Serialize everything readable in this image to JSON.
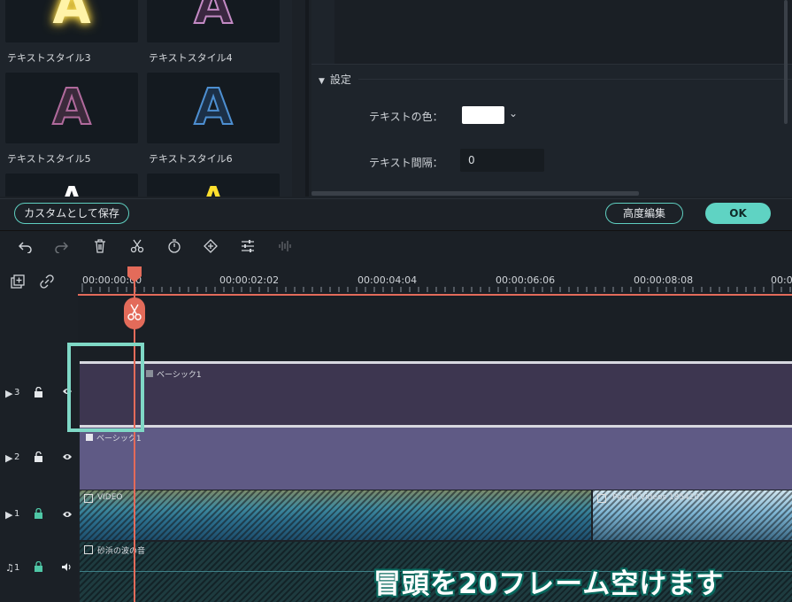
{
  "text_styles": [
    {
      "label": "テキストスタイル3",
      "glyph": "A",
      "color": "#ffe98a"
    },
    {
      "label": "テキストスタイル4",
      "glyph": "A",
      "color": "#8a4f86"
    },
    {
      "label": "テキストスタイル5",
      "glyph": "A",
      "color": "#7e3f6c"
    },
    {
      "label": "テキストスタイル6",
      "glyph": "A",
      "color": "#2d5b8e"
    },
    {
      "label": "",
      "glyph": "A",
      "color": "#ffffff"
    },
    {
      "label": "",
      "glyph": "A",
      "color": "#ffdf2c"
    }
  ],
  "settings": {
    "section_label": "設定",
    "text_color_label": "テキストの色：",
    "text_color_value": "#ffffff",
    "text_spacing_label": "テキスト間隔：",
    "text_spacing_value": "0"
  },
  "buttons": {
    "save_custom": "カスタムとして保存",
    "advanced_edit": "高度編集",
    "ok": "OK"
  },
  "toolbar": {
    "icons": [
      "undo-icon",
      "redo-icon",
      "delete-icon",
      "split-icon",
      "speed-icon",
      "keyframe-icon",
      "adjust-icon",
      "audio-wave-icon"
    ]
  },
  "timeline": {
    "ruler_labels": [
      "00:00:00:00",
      "00:00:02:02",
      "00:00:04:04",
      "00:00:06:06",
      "00:00:08:08",
      "00:0"
    ],
    "accent_color": "#e36b5a",
    "tracks": [
      {
        "id": "3",
        "clip_label": "ベーシック1"
      },
      {
        "id": "2",
        "clip_label": "ベーシック1"
      },
      {
        "id": "1",
        "clip_label": "VIDEO",
        "clip2_label": "Pexels Videos 1854202"
      },
      {
        "id": "1",
        "clip_label": "砂浜の波の音"
      }
    ]
  },
  "caption": "冒頭を20フレーム空けます"
}
